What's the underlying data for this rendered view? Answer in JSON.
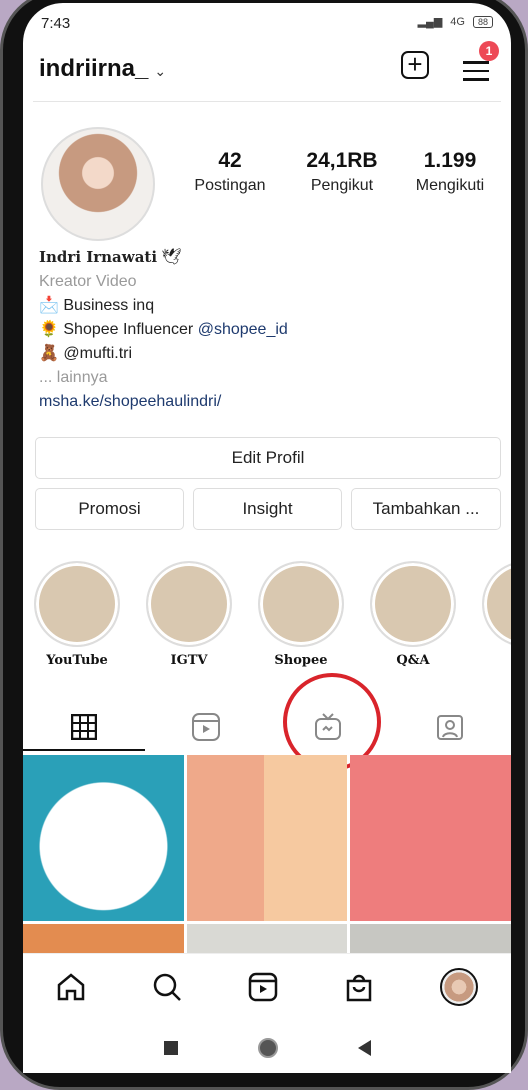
{
  "status_bar": {
    "time": "7:43",
    "battery": "88",
    "network": "4G"
  },
  "header": {
    "username": "indriirna_",
    "notification_count": "1"
  },
  "stats": [
    {
      "value": "42",
      "label": "Postingan"
    },
    {
      "value": "24,1RB",
      "label": "Pengikut"
    },
    {
      "value": "1.199",
      "label": "Mengikuti"
    }
  ],
  "bio": {
    "name": "Indri Irnawati",
    "name_emoji": "🕊",
    "category": "Kreator Video",
    "line1_emoji": "📩",
    "line1": "Business inq",
    "line2_emoji": "🌻",
    "line2": "Shopee Influencer ",
    "line2_mention": "@shopee_id",
    "line3_emoji": "🧸",
    "line3_mention": "@mufti.tri",
    "more": "... lainnya",
    "link": "msha.ke/shopeehaulindri/"
  },
  "buttons": {
    "edit": "Edit Profil",
    "promo": "Promosi",
    "insight": "Insight",
    "add": "Tambahkan ..."
  },
  "highlights": [
    "YouTube",
    "IGTV",
    "Shopee",
    "Q&A"
  ],
  "accent": {
    "badge": "#ed4956",
    "annotation": "#d9242b",
    "link": "#1e3a6e"
  }
}
